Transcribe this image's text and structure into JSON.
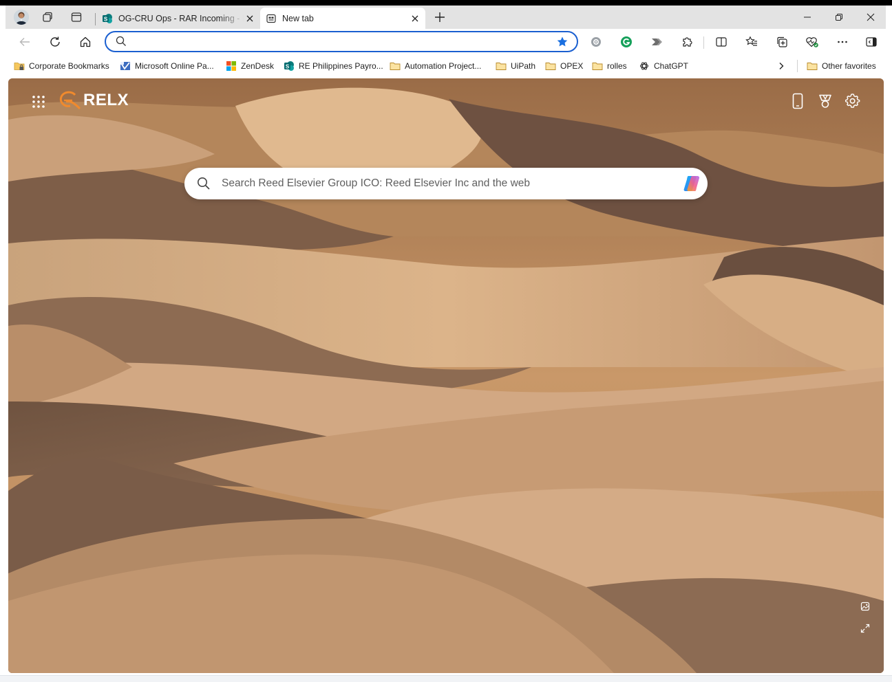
{
  "tabs": [
    {
      "title": "OG-CRU Ops - RAR Incoming - Di",
      "active": false,
      "close_label": "×"
    },
    {
      "title": "New tab",
      "active": true,
      "close_label": "×"
    }
  ],
  "new_tab_label": "+",
  "address": {
    "value": "",
    "placeholder": ""
  },
  "bookmarks": [
    {
      "label": "Corporate Bookmarks",
      "icon": "folder-lock-icon"
    },
    {
      "label": "Microsoft Online Pa...",
      "icon": "microsoft-online-icon"
    },
    {
      "label": "ZenDesk",
      "icon": "windows-tiles-icon"
    },
    {
      "label": "RE Philippines Payro...",
      "icon": "sharepoint-icon"
    },
    {
      "label": "Automation Project...",
      "icon": "folder-icon"
    },
    {
      "label": "UiPath",
      "icon": "folder-icon"
    },
    {
      "label": "OPEX",
      "icon": "folder-icon"
    },
    {
      "label": "rolles",
      "icon": "folder-icon"
    },
    {
      "label": "ChatGPT",
      "icon": "chatgpt-icon"
    }
  ],
  "other_favorites": "Other favorites",
  "newtab": {
    "brand": "RELX",
    "search_placeholder": "Search Reed Elsevier Group ICO: Reed Elsevier Inc and the web"
  },
  "colors": {
    "accent": "#1a5fd0",
    "brand_orange": "#f08a2d",
    "tabstrip": "#e3e3e3"
  }
}
